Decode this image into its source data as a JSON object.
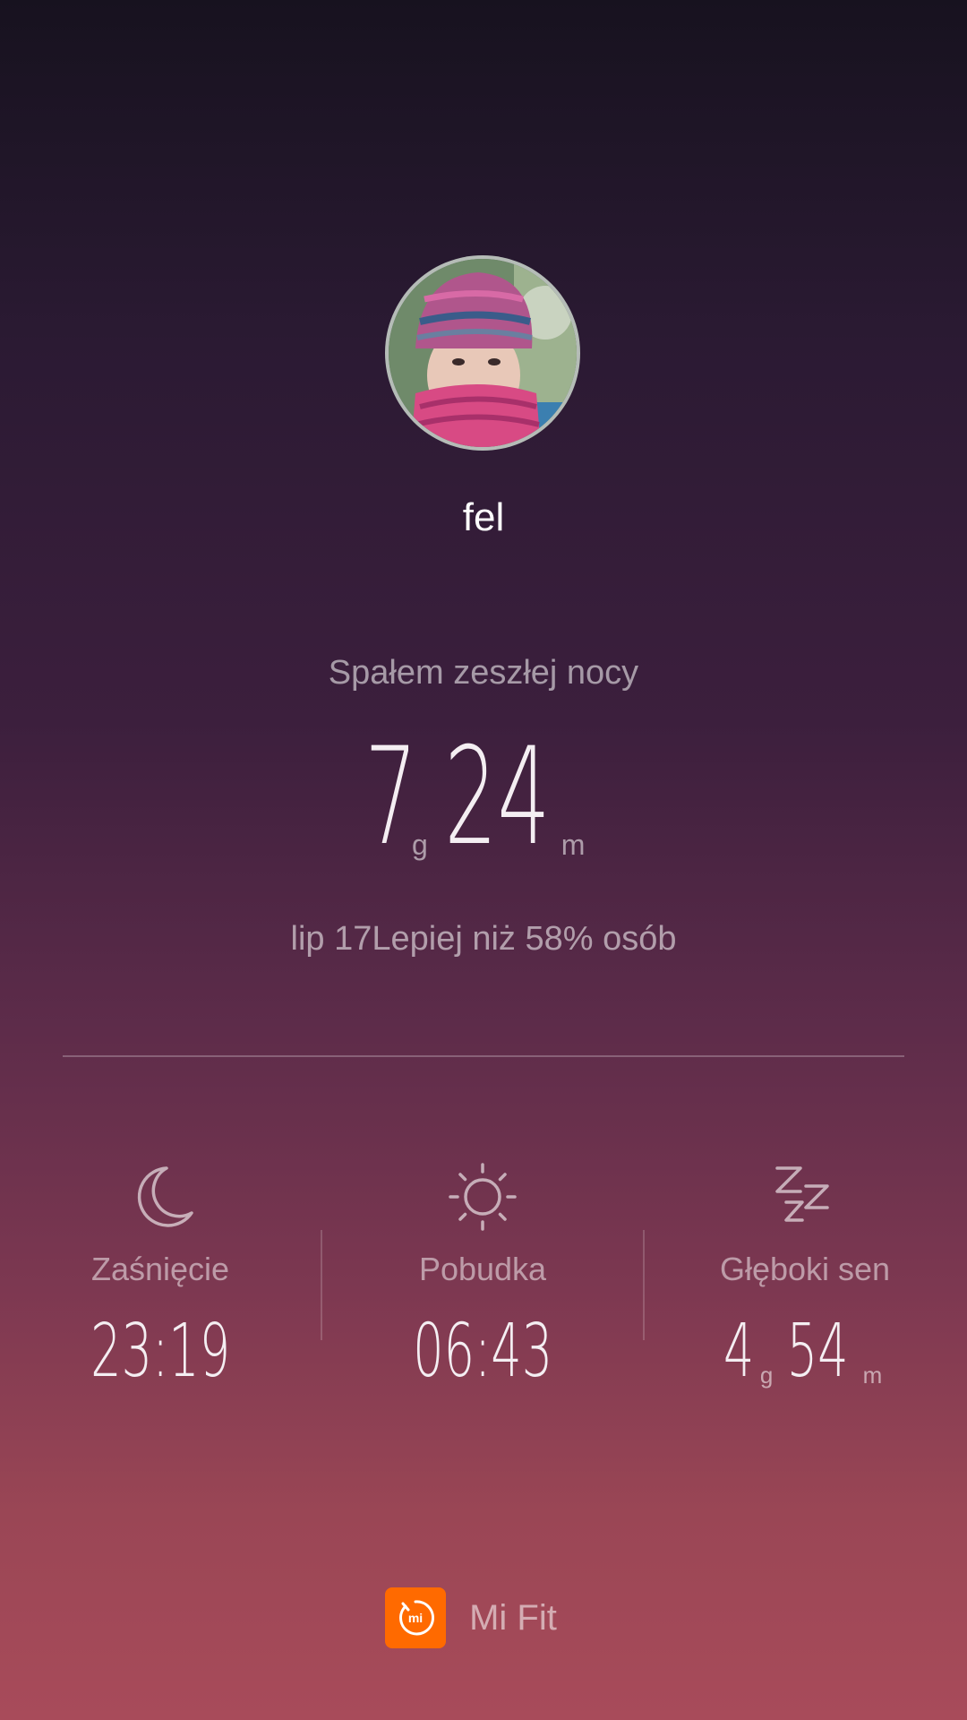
{
  "profile": {
    "username": "fel",
    "avatar_icon": "user-avatar-photo"
  },
  "summary": {
    "subtitle": "Spałem zeszłej nocy",
    "hours": "7",
    "hours_unit": "g",
    "minutes": "24",
    "minutes_unit": "m",
    "caption": "lip 17Lepiej niż 58% osób"
  },
  "stats": [
    {
      "icon": "moon-icon",
      "label": "Zaśnięcie",
      "value": "23:19"
    },
    {
      "icon": "sun-icon",
      "label": "Pobudka",
      "value": "06:43"
    },
    {
      "icon": "zzz-icon",
      "label": "Głęboki sen",
      "hours": "4",
      "hours_unit": "g",
      "minutes": "54",
      "minutes_unit": "m"
    }
  ],
  "footer": {
    "brand_icon": "mi-logo-icon",
    "brand_name": "Mi Fit"
  },
  "colors": {
    "accent_orange": "#ff6a00",
    "gradient_top": "#17121f",
    "gradient_bottom": "#a84b5a"
  }
}
